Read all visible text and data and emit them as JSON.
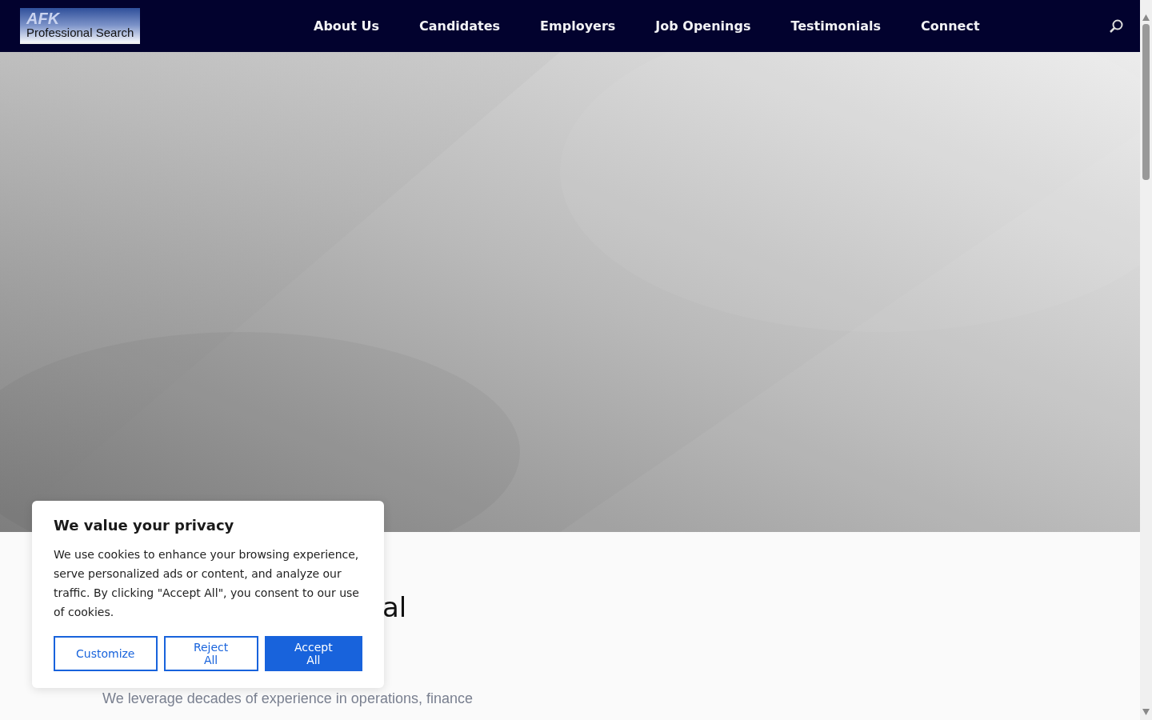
{
  "header": {
    "logo": {
      "top": "AFK",
      "bottom": "Professional Search"
    },
    "nav": [
      {
        "label": "About Us"
      },
      {
        "label": "Candidates"
      },
      {
        "label": "Employers"
      },
      {
        "label": "Job Openings"
      },
      {
        "label": "Testimonials"
      },
      {
        "label": "Connect"
      }
    ]
  },
  "intro": {
    "heading_fragment": "al",
    "text": "We leverage decades of experience in operations, finance"
  },
  "cookie_dialog": {
    "title": "We value your privacy",
    "text": "We use cookies to enhance your browsing experience, serve personalized ads or content, and analyze our traffic. By clicking \"Accept All\", you consent to our use of cookies.",
    "buttons": [
      {
        "label": "Customize",
        "kind": "outline"
      },
      {
        "label": "Reject All",
        "kind": "outline"
      },
      {
        "label": "Accept All",
        "kind": "primary"
      }
    ]
  }
}
